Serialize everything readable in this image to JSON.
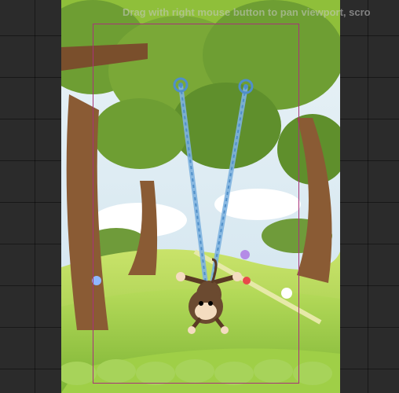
{
  "viewport": {
    "hint_text": "Drag with right mouse button to pan viewport, scro"
  },
  "scene": {
    "background": "forest-swing-scene",
    "character": "monkey",
    "ropes": 2
  },
  "colors": {
    "editor_background": "#2b2b2b",
    "camera_frame": "#a8327a",
    "rope": "#7fb3e0",
    "anchor": "#4f8fc9"
  },
  "icons": [
    "rope-anchor-icon",
    "monkey-sprite"
  ]
}
